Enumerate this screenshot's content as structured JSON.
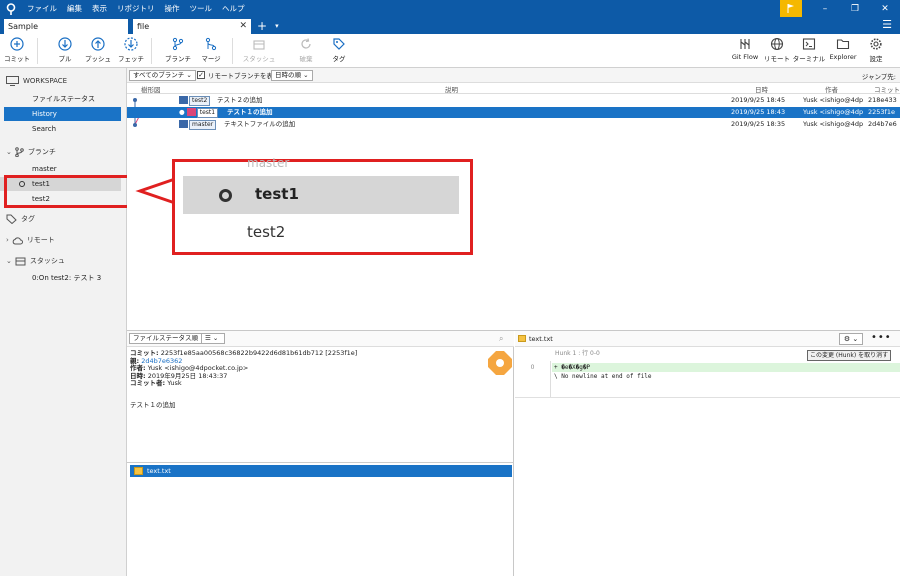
{
  "menu": [
    "ファイル",
    "編集",
    "表示",
    "リポジトリ",
    "操作",
    "ツール",
    "ヘルプ"
  ],
  "tabs": {
    "sample": "Sample",
    "file": "file"
  },
  "toolbar": {
    "commit": "コミット",
    "pull": "プル",
    "push": "プッシュ",
    "fetch": "フェッチ",
    "branch": "ブランチ",
    "merge": "マージ",
    "stash": "スタッシュ",
    "discard": "破棄",
    "tag": "タグ",
    "gitflow": "Git Flow",
    "remote": "リモート",
    "terminal": "ターミナル",
    "explorer": "Explorer",
    "settings": "設定"
  },
  "sidebar": {
    "workspace": "WORKSPACE",
    "file_status": "ファイルステータス",
    "history": "History",
    "search": "Search",
    "branches": "ブランチ",
    "branch_items": [
      "master",
      "test1",
      "test2"
    ],
    "tags": "タグ",
    "remotes": "リモート",
    "stashes": "スタッシュ",
    "stash_item": "0:On test2: テスト 3"
  },
  "filterbar": {
    "all_branches": "すべてのブランチ",
    "show_remote": "リモートブランチを表示",
    "date_order": "日時の順",
    "jump_to": "ジャンプ先:"
  },
  "commit_table": {
    "headers": {
      "graph": "樹形図",
      "description": "説明",
      "date": "日時",
      "author": "作者",
      "commit": "コミット"
    },
    "rows": [
      {
        "branch": "test2",
        "description": "テスト２の追加",
        "date": "2019/9/25  18:45",
        "author": "Yusk <ishigo@4dp",
        "commit": "218e433"
      },
      {
        "branch": "test1",
        "description": "テスト１の追加",
        "date": "2019/9/25  18:43",
        "author": "Yusk <ishigo@4dp",
        "commit": "2253f1e"
      },
      {
        "branch": "master",
        "description": "テキストファイルの追加",
        "date": "2019/9/25  18:35",
        "author": "Yusk <ishigo@4dp",
        "commit": "2d4b7e6"
      }
    ]
  },
  "callout": {
    "item1": "test1",
    "item2": "test2"
  },
  "details": {
    "sort_label": "ファイルステータス順",
    "commit_label": "コミット:",
    "commit_value": "2253f1e85aa00568c36822b9422d6d81b61db712 [2253f1e]",
    "parent_label": "親:",
    "parent_value": "2d4b7e6362",
    "author_label": "作者:",
    "author_value": "Yusk <ishigo@4dpocket.co.jp>",
    "date_label": "日時:",
    "date_value": "2019年9月25日 18:43:37",
    "committer_label": "コミット者:",
    "committer_value": "Yusk",
    "message": "テスト１の追加",
    "file": "text.txt"
  },
  "diff": {
    "file": "text.txt",
    "hunk": "Hunk 1 : 行 0-0",
    "discard_hunk": "この変更 (Hunk) を取り消す",
    "line_no": "0",
    "added_line": "+ �e�X�g�P",
    "no_newline": "\\  No newline at end of file"
  },
  "colors": {
    "accent": "#0d5aa7",
    "selection": "#1a73c6",
    "callout_border": "#e02020"
  }
}
